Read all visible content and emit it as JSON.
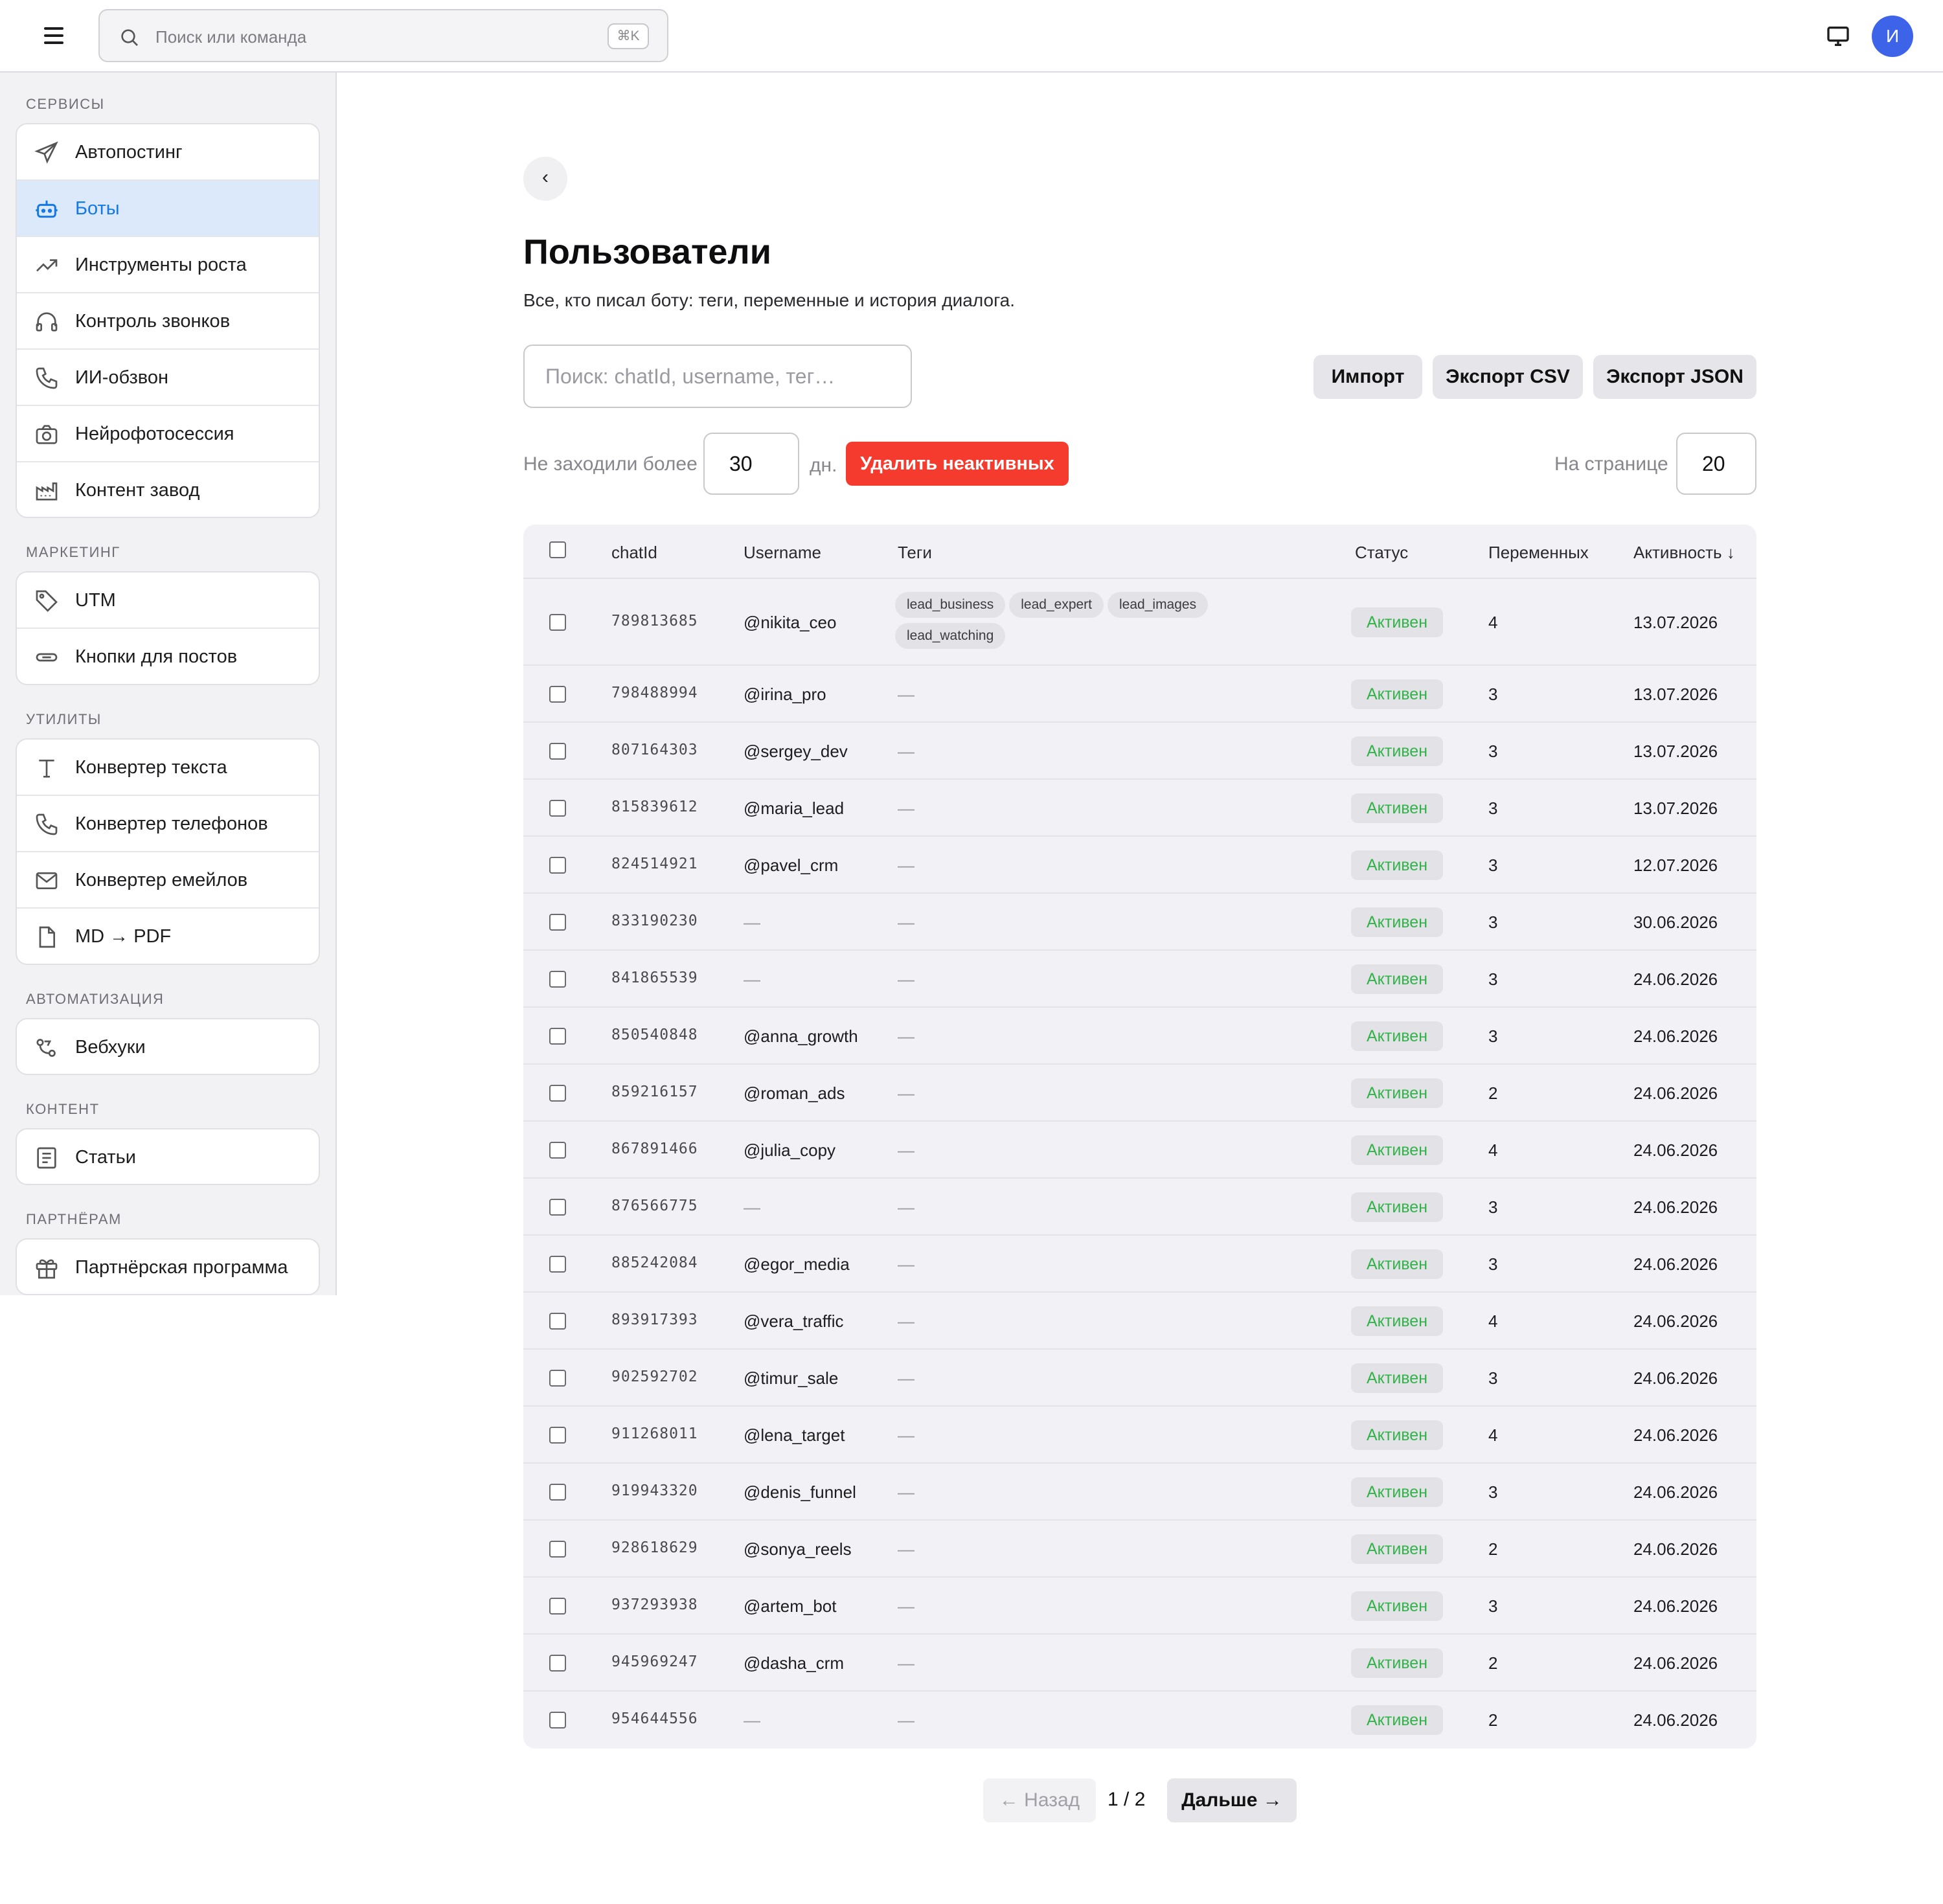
{
  "topbar": {
    "search_placeholder": "Поиск или команда",
    "search_shortcut": "⌘K",
    "avatar_initial": "И"
  },
  "sidebar": {
    "sections": [
      {
        "title": "СЕРВИСЫ",
        "items": [
          {
            "label": "Автопостинг",
            "icon": "send-icon"
          },
          {
            "label": "Боты",
            "icon": "bot-icon",
            "active": true
          },
          {
            "label": "Инструменты роста",
            "icon": "trending-up-icon"
          },
          {
            "label": "Контроль звонков",
            "icon": "headphones-icon"
          },
          {
            "label": "ИИ-обзвон",
            "icon": "phone-icon"
          },
          {
            "label": "Нейрофотосессия",
            "icon": "camera-icon"
          },
          {
            "label": "Контент завод",
            "icon": "factory-icon"
          }
        ]
      },
      {
        "title": "МАРКЕТИНГ",
        "items": [
          {
            "label": "UTM",
            "icon": "tag-icon"
          },
          {
            "label": "Кнопки для постов",
            "icon": "button-icon"
          }
        ]
      },
      {
        "title": "УТИЛИТЫ",
        "items": [
          {
            "label": "Конвертер текста",
            "icon": "text-icon"
          },
          {
            "label": "Конвертер телефонов",
            "icon": "phone-icon"
          },
          {
            "label": "Конвертер емейлов",
            "icon": "mail-icon"
          },
          {
            "label": "MD → PDF",
            "icon": "file-icon"
          }
        ]
      },
      {
        "title": "АВТОМАТИЗАЦИЯ",
        "items": [
          {
            "label": "Вебхуки",
            "icon": "webhook-icon"
          }
        ]
      },
      {
        "title": "КОНТЕНТ",
        "items": [
          {
            "label": "Статьи",
            "icon": "article-icon"
          }
        ]
      },
      {
        "title": "ПАРТНЁРАМ",
        "items": [
          {
            "label": "Партнёрская программа",
            "icon": "gift-icon"
          }
        ]
      }
    ]
  },
  "main": {
    "back_label": "‹",
    "title": "Пользователи",
    "subtitle": "Все, кто писал боту: теги, переменные и история диалога.",
    "search_placeholder": "Поиск: chatId, username, тег…",
    "import_label": "Импорт",
    "export_csv_label": "Экспорт CSV",
    "export_json_label": "Экспорт JSON",
    "inactive_prefix": "Не заходили более",
    "inactive_days": "30",
    "inactive_suffix": "дн.",
    "delete_inactive_label": "Удалить неактивных",
    "per_page_label": "На странице",
    "per_page_value": "20"
  },
  "table": {
    "columns": [
      "chatId",
      "Username",
      "Теги",
      "Статус",
      "Переменных",
      "Активность ↓"
    ],
    "rows": [
      {
        "chatId": "789813685",
        "username": "@nikita_ceo",
        "tags": [
          "lead_business",
          "lead_expert",
          "lead_images",
          "lead_watching"
        ],
        "status": "Активен",
        "vars": "4",
        "activity": "13.07.2026"
      },
      {
        "chatId": "798488994",
        "username": "@irina_pro",
        "tags": [],
        "status": "Активен",
        "vars": "3",
        "activity": "13.07.2026"
      },
      {
        "chatId": "807164303",
        "username": "@sergey_dev",
        "tags": [],
        "status": "Активен",
        "vars": "3",
        "activity": "13.07.2026"
      },
      {
        "chatId": "815839612",
        "username": "@maria_lead",
        "tags": [],
        "status": "Активен",
        "vars": "3",
        "activity": "13.07.2026"
      },
      {
        "chatId": "824514921",
        "username": "@pavel_crm",
        "tags": [],
        "status": "Активен",
        "vars": "3",
        "activity": "12.07.2026"
      },
      {
        "chatId": "833190230",
        "username": "—",
        "tags": [],
        "status": "Активен",
        "vars": "3",
        "activity": "30.06.2026"
      },
      {
        "chatId": "841865539",
        "username": "—",
        "tags": [],
        "status": "Активен",
        "vars": "3",
        "activity": "24.06.2026"
      },
      {
        "chatId": "850540848",
        "username": "@anna_growth",
        "tags": [],
        "status": "Активен",
        "vars": "3",
        "activity": "24.06.2026"
      },
      {
        "chatId": "859216157",
        "username": "@roman_ads",
        "tags": [],
        "status": "Активен",
        "vars": "2",
        "activity": "24.06.2026"
      },
      {
        "chatId": "867891466",
        "username": "@julia_copy",
        "tags": [],
        "status": "Активен",
        "vars": "4",
        "activity": "24.06.2026"
      },
      {
        "chatId": "876566775",
        "username": "—",
        "tags": [],
        "status": "Активен",
        "vars": "3",
        "activity": "24.06.2026"
      },
      {
        "chatId": "885242084",
        "username": "@egor_media",
        "tags": [],
        "status": "Активен",
        "vars": "3",
        "activity": "24.06.2026"
      },
      {
        "chatId": "893917393",
        "username": "@vera_traffic",
        "tags": [],
        "status": "Активен",
        "vars": "4",
        "activity": "24.06.2026"
      },
      {
        "chatId": "902592702",
        "username": "@timur_sale",
        "tags": [],
        "status": "Активен",
        "vars": "3",
        "activity": "24.06.2026"
      },
      {
        "chatId": "911268011",
        "username": "@lena_target",
        "tags": [],
        "status": "Активен",
        "vars": "4",
        "activity": "24.06.2026"
      },
      {
        "chatId": "919943320",
        "username": "@denis_funnel",
        "tags": [],
        "status": "Активен",
        "vars": "3",
        "activity": "24.06.2026"
      },
      {
        "chatId": "928618629",
        "username": "@sonya_reels",
        "tags": [],
        "status": "Активен",
        "vars": "2",
        "activity": "24.06.2026"
      },
      {
        "chatId": "937293938",
        "username": "@artem_bot",
        "tags": [],
        "status": "Активен",
        "vars": "3",
        "activity": "24.06.2026"
      },
      {
        "chatId": "945969247",
        "username": "@dasha_crm",
        "tags": [],
        "status": "Активен",
        "vars": "2",
        "activity": "24.06.2026"
      },
      {
        "chatId": "954644556",
        "username": "—",
        "tags": [],
        "status": "Активен",
        "vars": "2",
        "activity": "24.06.2026"
      }
    ],
    "empty_mark": "—"
  },
  "pagination": {
    "prev_label": "← Назад",
    "page_indicator": "1 / 2",
    "next_label": "Дальше →"
  },
  "colors": {
    "accent": "#1479e3",
    "danger": "#f53a2e",
    "status_active": "#32b34a",
    "avatar": "#3d63e8"
  }
}
